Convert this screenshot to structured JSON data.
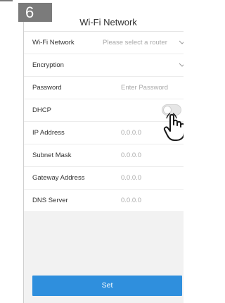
{
  "step": {
    "number": "6"
  },
  "header": {
    "title": "Wi-Fi Network"
  },
  "form": {
    "wifi_network": {
      "label": "Wi-Fi Network",
      "placeholder": "Please select a router"
    },
    "encryption": {
      "label": "Encryption"
    },
    "password": {
      "label": "Password",
      "placeholder": "Enter Password"
    },
    "dhcp": {
      "label": "DHCP",
      "enabled": false
    },
    "ip_address": {
      "label": "IP Address",
      "value": "0.0.0.0"
    },
    "subnet_mask": {
      "label": "Subnet Mask",
      "value": "0.0.0.0"
    },
    "gateway_address": {
      "label": "Gateway Address",
      "value": "0.0.0.0"
    },
    "dns_server": {
      "label": "DNS Server",
      "value": "0.0.0.0"
    }
  },
  "actions": {
    "set_label": "Set"
  },
  "icons": {
    "pointer": "hand-pointer-icon",
    "dropdown": "chevron-down-icon"
  },
  "colors": {
    "accent": "#2f8fdd",
    "badge": "#7b7b7b"
  }
}
